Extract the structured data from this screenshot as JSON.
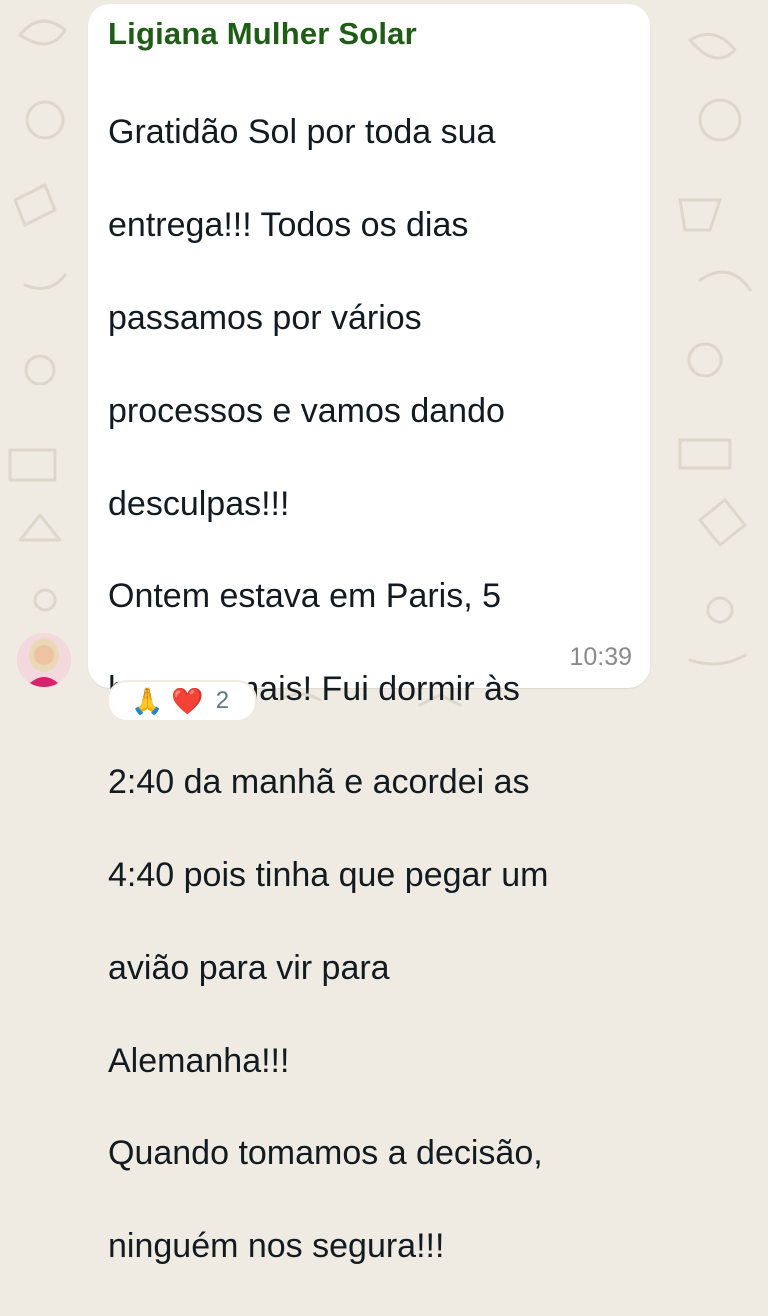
{
  "message": {
    "sender": "Ligiana Mulher Solar",
    "lines": [
      "Gratidão Sol por toda sua",
      "entrega!!! Todos os dias",
      "passamos por vários",
      "processos e vamos  dando",
      "desculpas!!!",
      "Ontem estava em Paris, 5",
      "horas a mais! Fui dormir às",
      "2:40 da manhã e acordei as",
      "4:40 pois tinha que pegar um",
      "avião para vir para",
      "Alemanha!!!",
      "Quando tomamos a decisão,",
      "ninguém nos segura!!!"
    ],
    "time": "10:39"
  },
  "reactions": {
    "first_emoji": "🙏",
    "second_emoji": "❤️",
    "count": "2"
  },
  "colors": {
    "background": "#efeae2",
    "bubble": "#ffffff",
    "sender_name": "#1f5d16",
    "timestamp": "#8a8a8a"
  },
  "icons": {
    "avatar": "sender-avatar"
  }
}
